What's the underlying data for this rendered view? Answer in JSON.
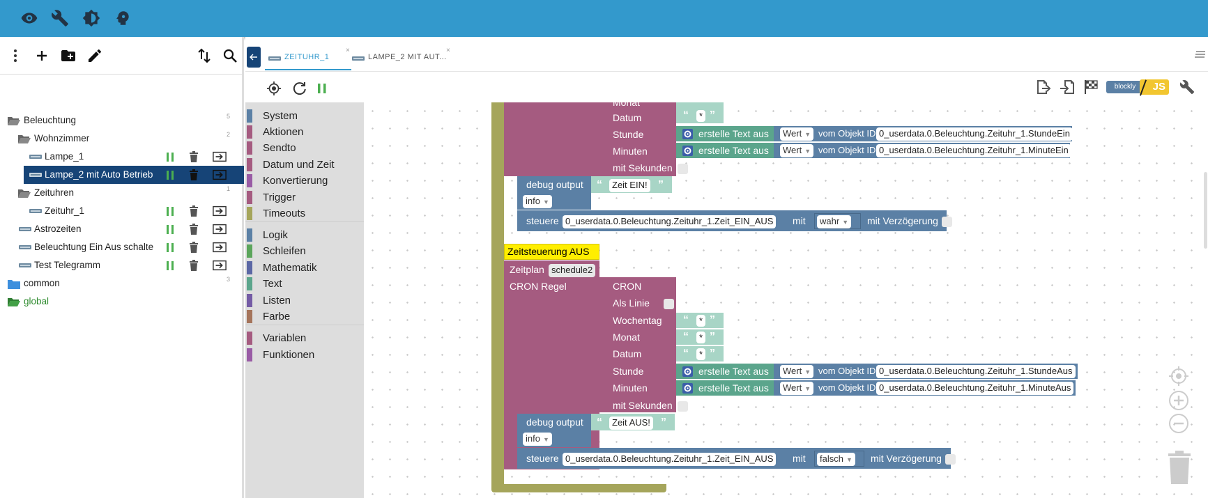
{
  "topbar": {
    "icons": [
      "eye-icon",
      "wrench-icon",
      "contrast-icon",
      "head-icon"
    ],
    "color": "#3399cc"
  },
  "left_toolbar": {
    "icons": [
      "more-vert-icon",
      "add-icon",
      "add-folder-icon",
      "edit-icon",
      "sort-icon",
      "search-icon"
    ]
  },
  "tree": {
    "beleuchtung": {
      "label": "Beleuchtung",
      "count": "5"
    },
    "wohnzimmer": {
      "label": "Wohnzimmer",
      "count": "2"
    },
    "lampe1": {
      "label": "Lampe_1"
    },
    "lampe2": {
      "label": "Lampe_2 mit Auto Betrieb"
    },
    "zeituhren": {
      "label": "Zeituhren",
      "count": "1"
    },
    "zeituhr1": {
      "label": "Zeituhr_1"
    },
    "astrozeiten": {
      "label": "Astrozeiten"
    },
    "ein_aus": {
      "label": "Beleuchtung Ein Aus schalter"
    },
    "telegramm": {
      "label": "Test Telegramm"
    },
    "common": {
      "label": "common",
      "count": "3"
    },
    "global": {
      "label": "global"
    }
  },
  "tabs": {
    "tab1": "ZEITUHR_1",
    "tab2": "LAMPE_2 MIT AUT...",
    "close": "×"
  },
  "toolbox": {
    "system": "System",
    "aktionen": "Aktionen",
    "sendto": "Sendto",
    "datum": "Datum und Zeit",
    "konvertierung": "Konvertierung",
    "trigger": "Trigger",
    "timeouts": "Timeouts",
    "logik": "Logik",
    "schleifen": "Schleifen",
    "mathematik": "Mathematik",
    "text": "Text",
    "listen": "Listen",
    "farbe": "Farbe",
    "variablen": "Variablen",
    "funktionen": "Funktionen"
  },
  "blocks": {
    "monat": "Monat",
    "datum": "Datum",
    "stunde": "Stunde",
    "minuten": "Minuten",
    "mit_sekunden": "mit Sekunden",
    "erstelle": "erstelle Text aus",
    "wert": "Wert",
    "vom_objekt": "vom Objekt ID",
    "stunde_ein_id": "0_userdata.0.Beleuchtung.Zeituhr_1.StundeEin",
    "minute_ein_id": "0_userdata.0.Beleuchtung.Zeituhr_1.MinuteEin",
    "stunde_aus_id": "0_userdata.0.Beleuchtung.Zeituhr_1.StundeAus",
    "minute_aus_id": "0_userdata.0.Beleuchtung.Zeituhr_1.MinuteAus",
    "star": "*",
    "debug_output": "debug output",
    "zeit_ein": "Zeit EIN!",
    "zeit_aus": "Zeit AUS!",
    "info": "info",
    "steuere": "steuere",
    "zeit_ein_aus_id": "0_userdata.0.Beleuchtung.Zeituhr_1.Zeit_EIN_AUS",
    "mit": "mit",
    "wahr": "wahr",
    "falsch": "falsch",
    "mit_verzoegerung": "mit Verzögerung",
    "comment": "Zeitsteuerung AUS",
    "zeitplan": "Zeitplan",
    "schedule": "schedule2",
    "cron_regel": "CRON Regel",
    "cron": "CRON",
    "als_linie": "Als Linie",
    "wochentag": "Wochentag",
    "quote_open": "“",
    "quote_close": "”"
  },
  "blockly_label": "blockly",
  "js_label": "JS"
}
